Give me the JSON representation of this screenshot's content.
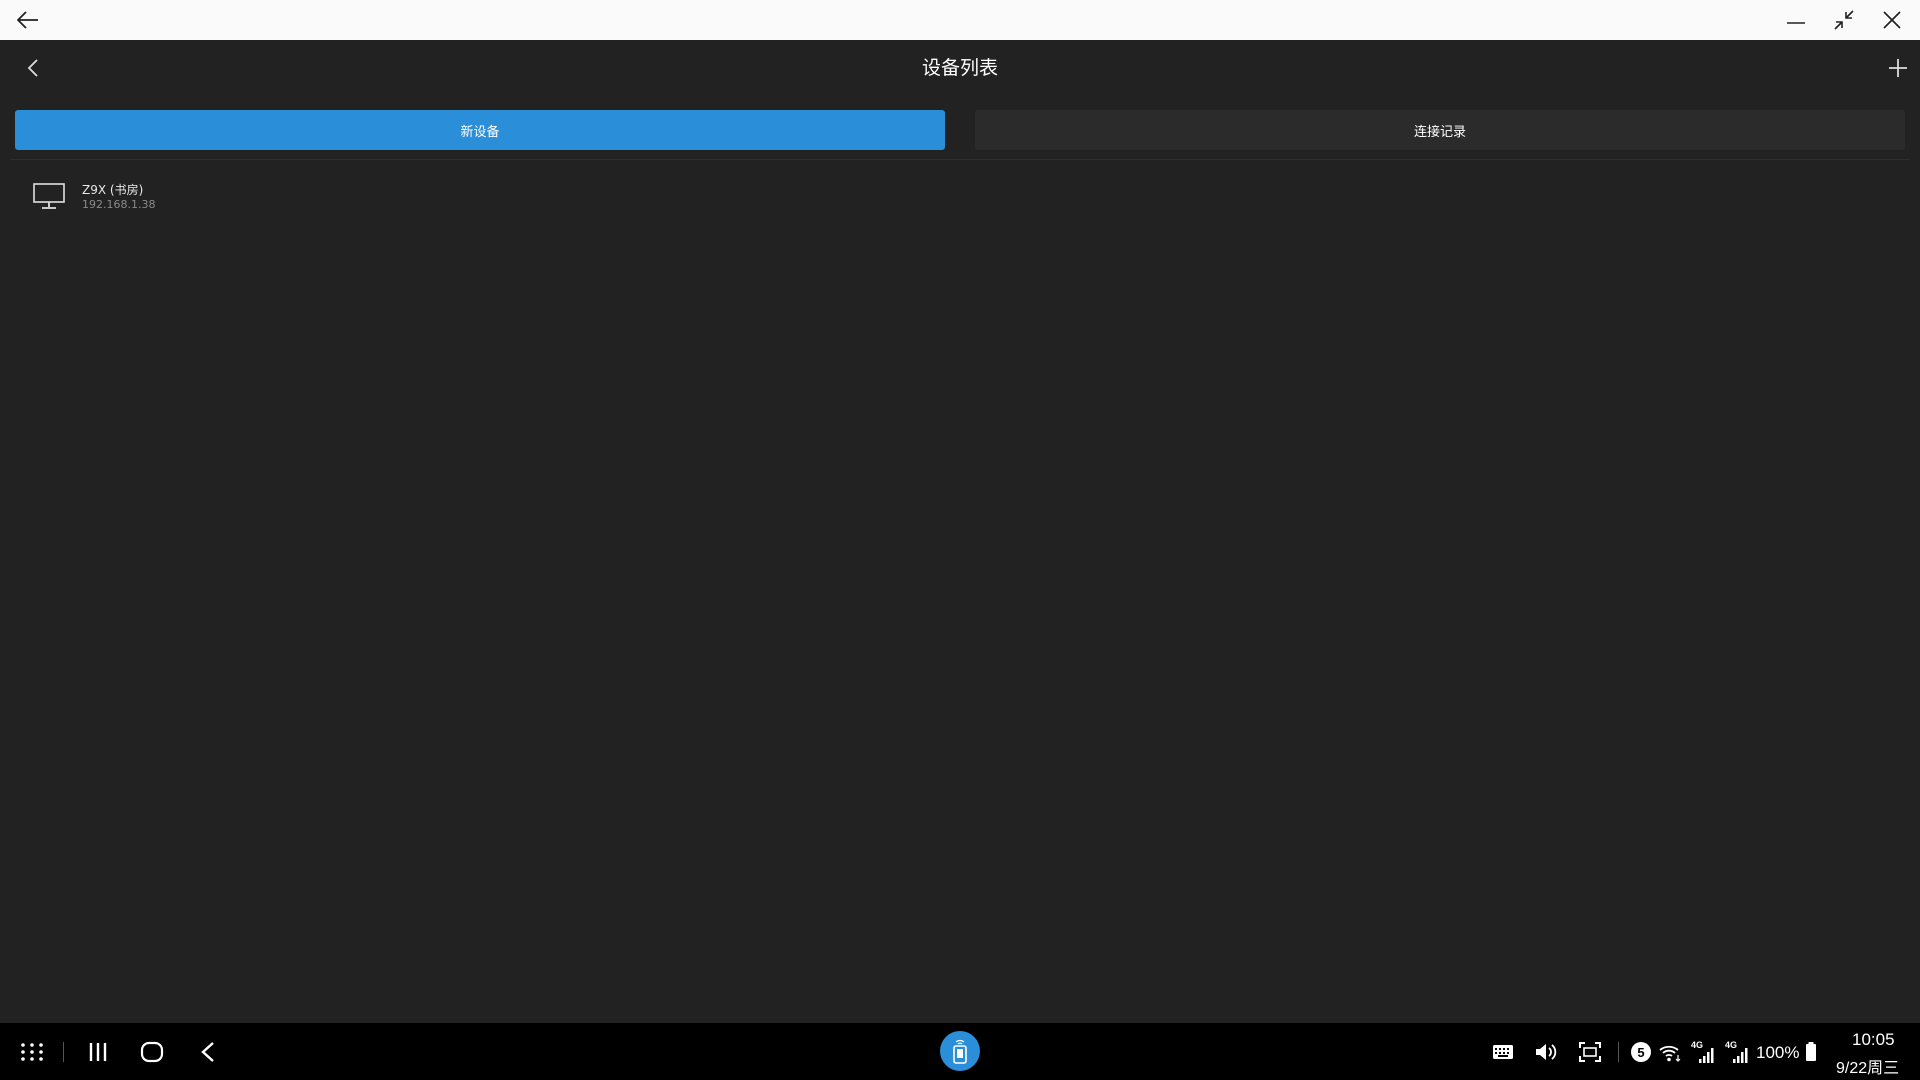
{
  "app": {
    "title": "设备列表"
  },
  "tabs": [
    {
      "label": "新设备",
      "active": true
    },
    {
      "label": "连接记录",
      "active": false
    }
  ],
  "devices": [
    {
      "name": "Z9X (书房)",
      "ip": "192.168.1.38",
      "icon": "monitor-icon"
    }
  ],
  "status": {
    "notification_count": "5",
    "network_1": "4G",
    "network_2": "4G",
    "battery": "100%",
    "time": "10:05",
    "date": "9/22周三"
  },
  "colors": {
    "accent": "#2b8ed8",
    "background": "#222222",
    "taskbar": "#000000",
    "window_bar": "#fafafa"
  }
}
